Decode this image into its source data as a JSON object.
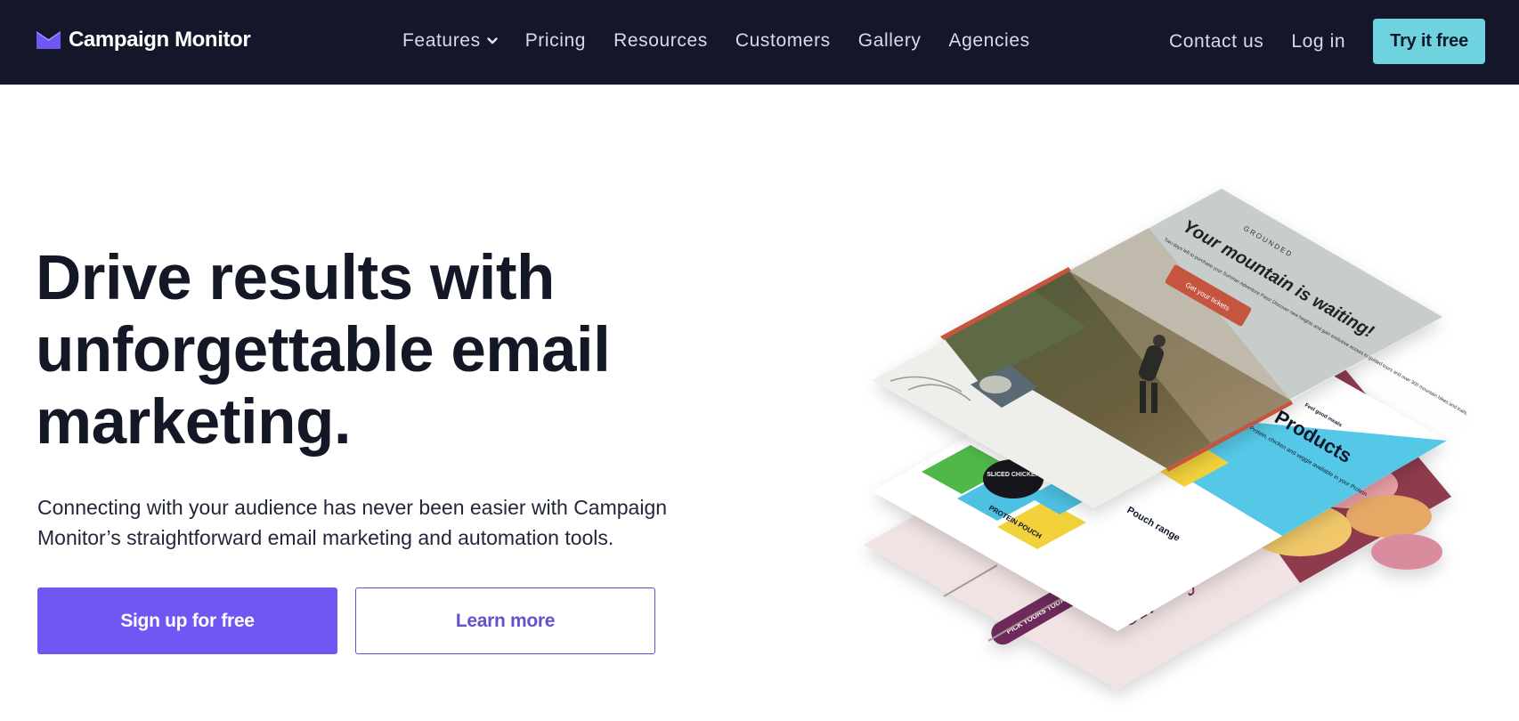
{
  "nav": {
    "brand": "Campaign Monitor",
    "links": [
      "Features",
      "Pricing",
      "Resources",
      "Customers",
      "Gallery",
      "Agencies"
    ],
    "contact": "Contact us",
    "login": "Log in",
    "cta": "Try it free"
  },
  "hero": {
    "title_line1": "Drive results with",
    "title_line2": "unforgettable email",
    "title_line3": "marketing.",
    "subtitle_line1": "Connecting with your audience has never been easier with Campaign",
    "subtitle_line2": "Monitor’s straightforward email marketing and automation tools.",
    "primary_cta": "Sign up for free",
    "secondary_cta": "Learn more"
  },
  "illustration": {
    "brand_mark": "GROUNDED",
    "headline": "Your mountain is waiting!",
    "body": "Two days left to purchase your Summer Adventure Pass! Discover new heights and gain exclusive access to guided tours and over 300 mountain hikes and trails.",
    "button": "Get your tickets",
    "products_title": "Products",
    "products_tag": "Feel good meals",
    "products_body": "Protein, chicken and veggie available in your Protein",
    "pouch_label": "PROTEIN POUCH",
    "sliced_label": "SLICED CHICKEN",
    "pouch_range": "Pouch range",
    "day_text": "day",
    "er_text": "er.",
    "macaron_button": "PICK YOURS TODAY"
  },
  "colors": {
    "nav_bg": "#131729",
    "accent": "#7057f3",
    "cta_teal": "#6ed3df",
    "text_dark": "#141826",
    "products_blue": "#55c8e8",
    "email_red": "#c65440"
  }
}
